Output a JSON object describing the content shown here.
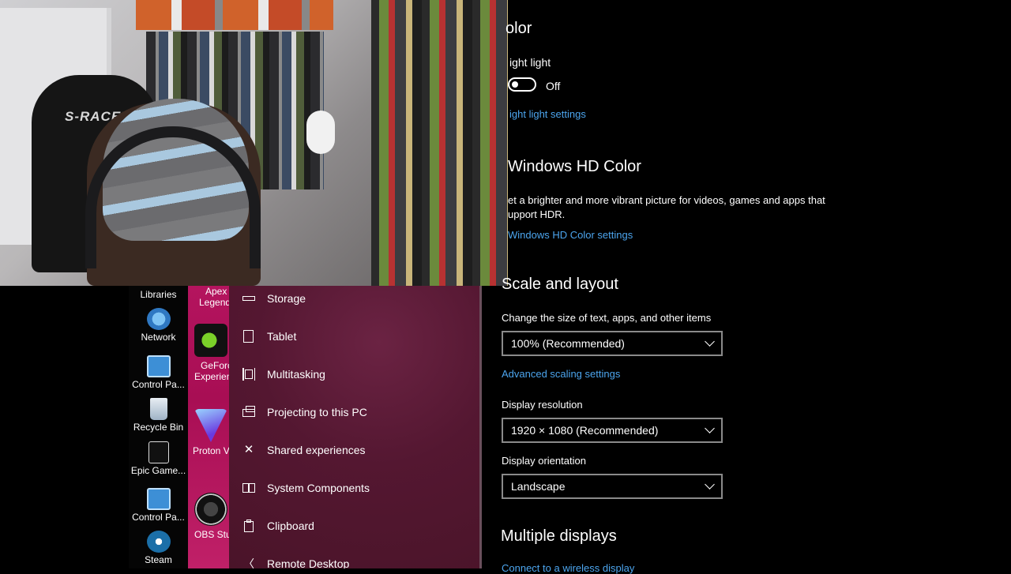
{
  "webcam": {
    "chair_text": "S-RACER"
  },
  "desktop_icons": [
    {
      "label": "Libraries",
      "icon": "libraries-icon"
    },
    {
      "label": "Network",
      "icon": "network-icon"
    },
    {
      "label": "Control Pa...",
      "icon": "control-panel-icon"
    },
    {
      "label": "Recycle Bin",
      "icon": "recycle-bin-icon"
    },
    {
      "label": "Epic Game...",
      "icon": "epic-games-icon"
    },
    {
      "label": "Control Pa...",
      "icon": "control-panel-icon"
    },
    {
      "label": "Steam",
      "icon": "steam-icon"
    }
  ],
  "desktop_mid_icons": [
    {
      "label": "Apex",
      "label2": "Legend",
      "icon": "apex-legends-icon"
    },
    {
      "label": "GeForc",
      "label2": "Experien",
      "icon": "geforce-experience-icon"
    },
    {
      "label": "Proton V",
      "icon": "proton-vpn-icon"
    },
    {
      "label": "OBS Stud",
      "icon": "obs-studio-icon"
    }
  ],
  "nav": {
    "items": [
      {
        "label": "Storage",
        "icon": "storage-icon"
      },
      {
        "label": "Tablet",
        "icon": "tablet-icon"
      },
      {
        "label": "Multitasking",
        "icon": "multitasking-icon"
      },
      {
        "label": "Projecting to this PC",
        "icon": "projecting-icon"
      },
      {
        "label": "Shared experiences",
        "icon": "shared-experiences-icon"
      },
      {
        "label": "System Components",
        "icon": "system-components-icon"
      },
      {
        "label": "Clipboard",
        "icon": "clipboard-icon"
      },
      {
        "label": "Remote Desktop",
        "icon": "remote-desktop-icon"
      }
    ]
  },
  "settings": {
    "color_heading": "olor",
    "night_light_label": "ight light",
    "night_light_state": "Off",
    "night_light_link": "ight light settings",
    "hd_color_heading": "Windows HD Color",
    "hd_color_desc_1": "et a brighter and more vibrant picture for videos, games and apps that",
    "hd_color_desc_2": "upport HDR.",
    "hd_color_link": "Windows HD Color settings",
    "scale_heading": "Scale and layout",
    "scale_label": "Change the size of text, apps, and other items",
    "scale_value": "100% (Recommended)",
    "advanced_scaling_link": "Advanced scaling settings",
    "resolution_label": "Display resolution",
    "resolution_value": "1920 × 1080 (Recommended)",
    "orientation_label": "Display orientation",
    "orientation_value": "Landscape",
    "multiple_displays_heading": "Multiple displays",
    "connect_link": "Connect to a wireless display"
  },
  "colors": {
    "link": "#4ca5ee",
    "nav_bg": "#541731",
    "desktop_wallpaper": "#b4145e"
  }
}
